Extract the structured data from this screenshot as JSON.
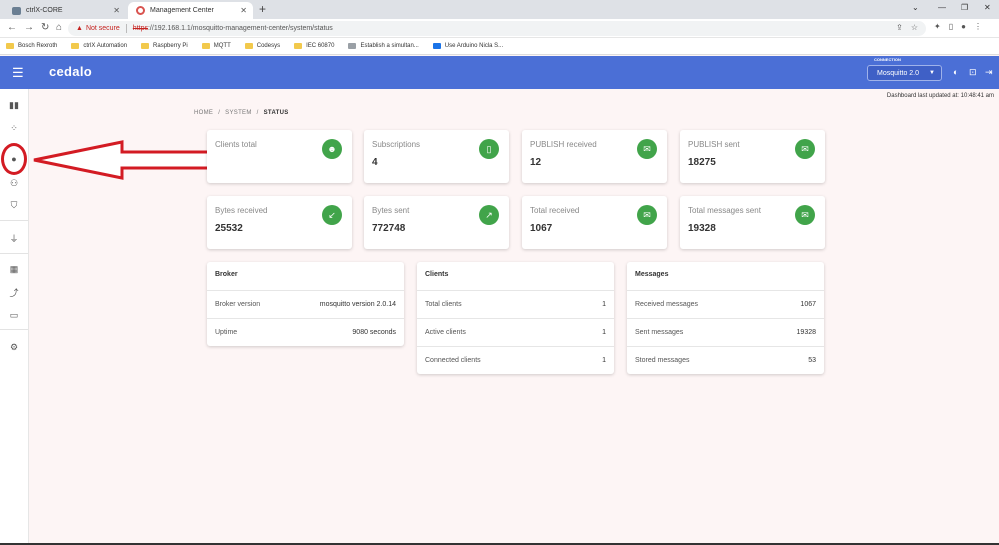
{
  "browser": {
    "tabs": [
      {
        "label": "ctrlX-CORE",
        "active": false
      },
      {
        "label": "Management Center",
        "active": true
      }
    ],
    "address": {
      "not_secure": "Not secure",
      "scheme": "https",
      "rest": "://192.168.1.1/mosquitto-management-center/system/status"
    },
    "bookmarks": [
      "Bosch Rexroth",
      "ctrlX Automation",
      "Raspberry Pi",
      "MQTT",
      "Codesys",
      "IEC 60870",
      "Establish a simultan...",
      "Use Arduino Nicla S..."
    ]
  },
  "app": {
    "brand": "cedalo",
    "connection_label": "CONNECTION",
    "connection_value": "Mosquitto 2.0",
    "header_color": "#4b6fd6",
    "accent_green": "#41a44a"
  },
  "status": {
    "updated": "Dashboard last updated at: 10:48:41 am",
    "breadcrumb": [
      "HOME",
      "SYSTEM",
      "STATUS"
    ]
  },
  "stats": [
    {
      "label": "Clients total",
      "value": "",
      "icon": "clients-icon"
    },
    {
      "label": "Subscriptions",
      "value": "4",
      "icon": "subscriptions-icon"
    },
    {
      "label": "PUBLISH received",
      "value": "12",
      "icon": "mail-icon"
    },
    {
      "label": "PUBLISH sent",
      "value": "18275",
      "icon": "mail-icon"
    },
    {
      "label": "Bytes received",
      "value": "25532",
      "icon": "arrow-down-left-icon"
    },
    {
      "label": "Bytes sent",
      "value": "772748",
      "icon": "arrow-up-right-icon"
    },
    {
      "label": "Total received",
      "value": "1067",
      "icon": "mail-icon"
    },
    {
      "label": "Total messages sent",
      "value": "19328",
      "icon": "mail-icon"
    }
  ],
  "tables": [
    {
      "title": "Broker",
      "rows": [
        {
          "k": "Broker version",
          "v": "mosquitto version 2.0.14"
        },
        {
          "k": "Uptime",
          "v": "9080 seconds"
        }
      ]
    },
    {
      "title": "Clients",
      "rows": [
        {
          "k": "Total clients",
          "v": "1"
        },
        {
          "k": "Active clients",
          "v": "1"
        },
        {
          "k": "Connected clients",
          "v": "1"
        }
      ]
    },
    {
      "title": "Messages",
      "rows": [
        {
          "k": "Received messages",
          "v": "1067"
        },
        {
          "k": "Sent messages",
          "v": "19328"
        },
        {
          "k": "Stored messages",
          "v": "53"
        }
      ]
    }
  ]
}
